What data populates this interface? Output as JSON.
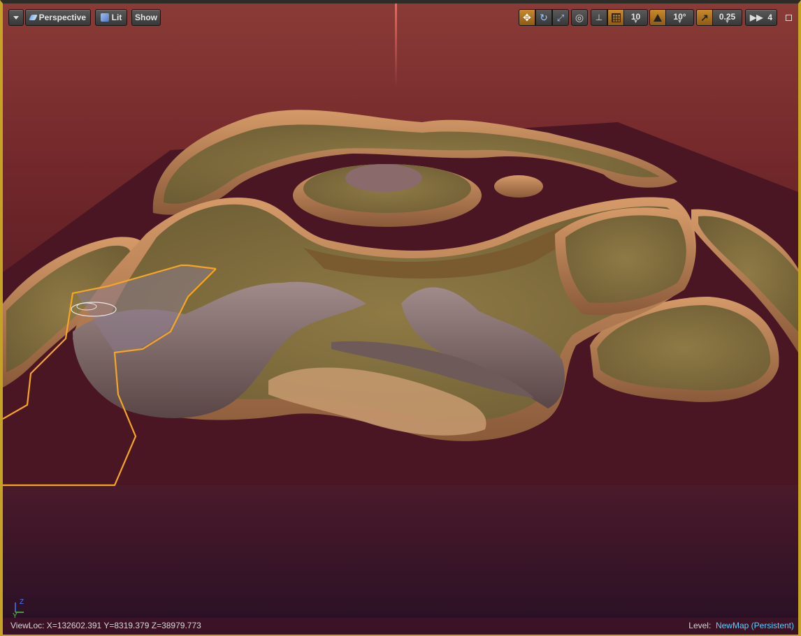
{
  "toolbar": {
    "menu_icon": "chevron-down-icon",
    "perspective_label": "Perspective",
    "lit_label": "Lit",
    "show_label": "Show",
    "translate_icon": "move-icon",
    "rotate_icon": "rotate-icon",
    "scale_icon": "scale-icon",
    "world_icon": "globe-icon",
    "surface_snap_icon": "surface-snap-icon",
    "grid_snap_icon": "grid-icon",
    "grid_snap_value": "10",
    "rotation_snap_icon": "rotation-snap-icon",
    "rotation_snap_value": "10°",
    "scale_snap_icon": "scale-snap-icon",
    "scale_snap_value": "0.25",
    "camera_speed_icon": "camera-speed-icon",
    "camera_speed_value": "4",
    "maximize_icon": "maximize-icon"
  },
  "status": {
    "viewloc": "ViewLoc: X=132602.391 Y=8319.379 Z=38979.773",
    "level_label": "Level:",
    "level_map": "NewMap (Persistent)"
  },
  "axis": {
    "z": "Z",
    "y": "Y"
  },
  "colors": {
    "selection_outline": "#f5a623",
    "active_toggle": "#c98a2c",
    "level_map": "#5fd0ff",
    "sky": "#7a2a2a",
    "water": "#3a1c2a"
  }
}
